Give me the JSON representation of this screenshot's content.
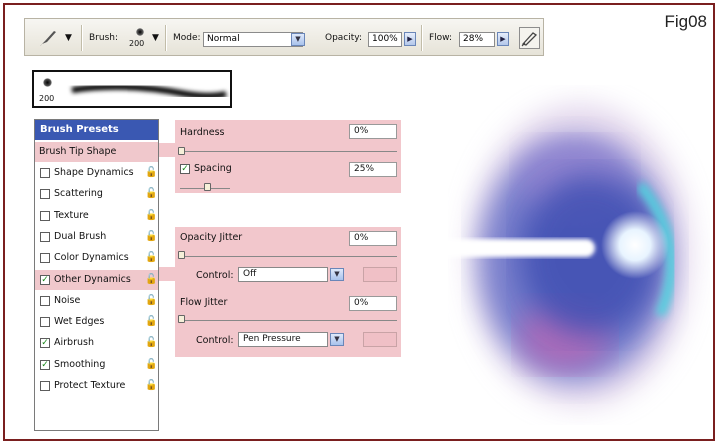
{
  "figure_label": "Fig08",
  "toolbar": {
    "brush_label": "Brush:",
    "brush_size": "200",
    "mode_label": "Mode:",
    "mode_value": "Normal",
    "opacity_label": "Opacity:",
    "opacity_value": "100%",
    "flow_label": "Flow:",
    "flow_value": "28%"
  },
  "preview": {
    "size": "200"
  },
  "left_panel": {
    "header": "Brush Presets",
    "tip_shape": "Brush Tip Shape",
    "items": [
      {
        "label": "Shape Dynamics",
        "checked": false
      },
      {
        "label": "Scattering",
        "checked": false
      },
      {
        "label": "Texture",
        "checked": false
      },
      {
        "label": "Dual Brush",
        "checked": false
      },
      {
        "label": "Color Dynamics",
        "checked": false
      },
      {
        "label": "Other Dynamics",
        "checked": true
      },
      {
        "label": "Noise",
        "checked": false
      },
      {
        "label": "Wet Edges",
        "checked": false
      },
      {
        "label": "Airbrush",
        "checked": true
      },
      {
        "label": "Smoothing",
        "checked": true
      },
      {
        "label": "Protect Texture",
        "checked": false
      }
    ]
  },
  "right_panel": {
    "hardness_label": "Hardness",
    "hardness_value": "0%",
    "spacing_label": "Spacing",
    "spacing_value": "25%",
    "opacity_jitter_label": "Opacity Jitter",
    "opacity_jitter_value": "0%",
    "control_label": "Control:",
    "control_opacity_value": "Off",
    "flow_jitter_label": "Flow Jitter",
    "flow_jitter_value": "0%",
    "control_flow_value": "Pen Pressure"
  }
}
